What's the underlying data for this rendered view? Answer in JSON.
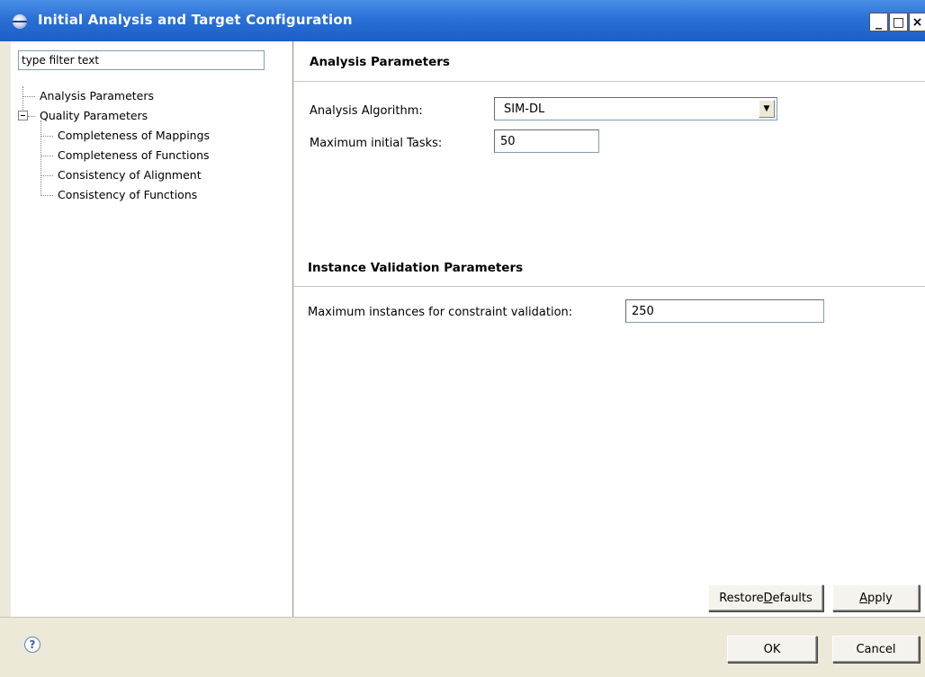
{
  "window": {
    "title": "Initial Analysis and Target Configuration",
    "minimize_label": "_",
    "maximize_label": "□",
    "close_label": "×"
  },
  "filter": {
    "value": "type filter text"
  },
  "tree": {
    "items": [
      {
        "label": "Analysis Parameters"
      },
      {
        "label": "Quality Parameters"
      },
      {
        "label": "Completeness of Mappings"
      },
      {
        "label": "Completeness of Functions"
      },
      {
        "label": "Consistency of Alignment"
      },
      {
        "label": "Consistency of Functions"
      }
    ]
  },
  "analysis": {
    "title": "Analysis Parameters",
    "algorithm_label": "Analysis Algorithm:",
    "algorithm_value": "SIM-DL",
    "max_tasks_label": "Maximum initial Tasks:",
    "max_tasks_value": "50"
  },
  "instance": {
    "title": "Instance Validation Parameters",
    "max_instances_label": "Maximum instances for constraint validation:",
    "max_instances_value": "250"
  },
  "buttons": {
    "restore_prefix": "Restore ",
    "restore_mnemonic": "D",
    "restore_suffix": "efaults",
    "apply_mnemonic": "A",
    "apply_suffix": "pply",
    "ok": "OK",
    "cancel": "Cancel"
  },
  "help": {
    "glyph": "?"
  }
}
